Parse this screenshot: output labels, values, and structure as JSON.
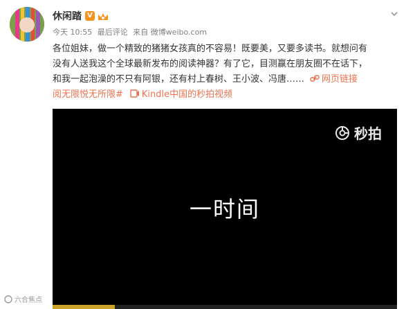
{
  "post": {
    "username": "休闲踏",
    "verified_badge": "V",
    "meta": {
      "time": "今天 10:55",
      "edited": "最后评论",
      "source": "来自 微博weibo.com"
    },
    "text": {
      "line1": "各位姐妹，做一个精致的猪猪女孩真的不容易！既要美，又要多读书。就想问有",
      "line2": "没有人送我这个全球最新发布的阅读神器？有了它，目测赢在朋友圈不在话下，",
      "line3_prefix": "和我一起泡澡的不只有阿银，还有村上春树、王小波、冯唐……",
      "web_link": "网页链接",
      "tag_suffix": "阅无限悦无所限#",
      "video_link": "Kindle中国的秒拍视频"
    }
  },
  "video": {
    "brand": "秒拍",
    "caption": "一时间",
    "progress_percent": 18
  },
  "watermark": "六合焦点",
  "icons": {
    "chevron": "chevron-down-icon",
    "crown": "crown-icon",
    "link": "link-icon",
    "video": "video-link-icon",
    "miaopai": "miaopai-logo-icon"
  },
  "colors": {
    "link": "#eb7350",
    "badge": "#f7931e",
    "video_bg": "#000000"
  }
}
